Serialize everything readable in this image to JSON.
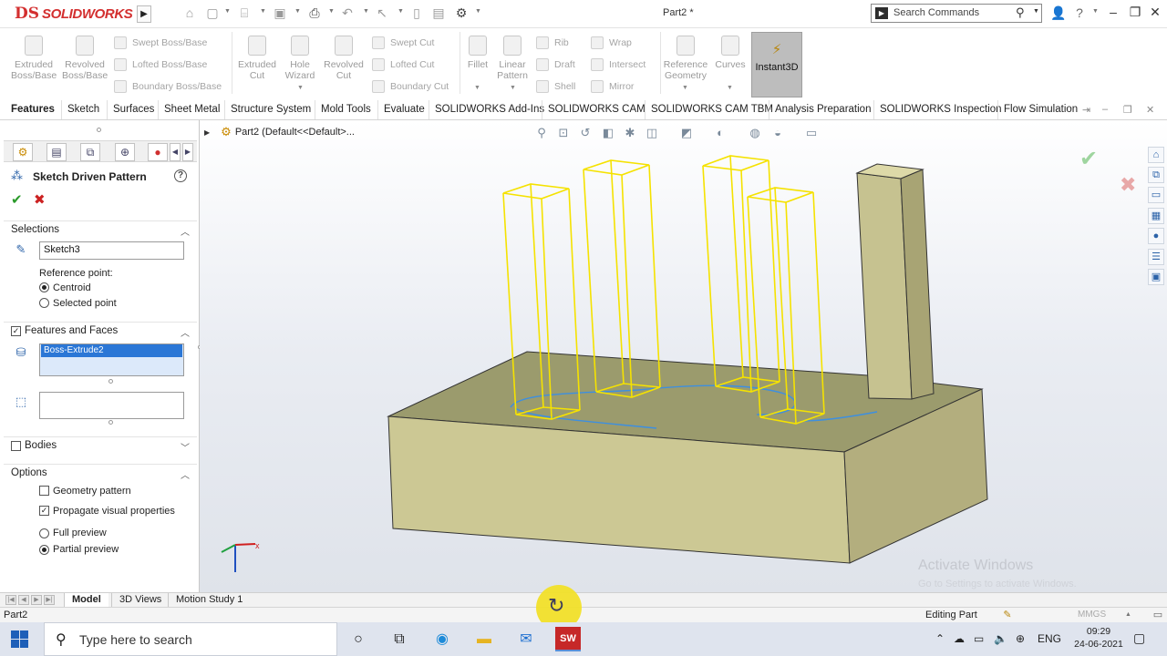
{
  "app": {
    "brand": "SOLIDWORKS",
    "brand_mark": "DS",
    "doc_title": "Part2 *",
    "search_placeholder": "Search Commands"
  },
  "ribbon": {
    "big_buttons": [
      {
        "label": "Extruded\nBoss/Base",
        "icon": "extrude-boss-icon"
      },
      {
        "label": "Revolved\nBoss/Base",
        "icon": "revolve-boss-icon"
      },
      {
        "label": "Extruded\nCut",
        "icon": "extrude-cut-icon"
      },
      {
        "label": "Hole\nWizard",
        "icon": "hole-wizard-icon"
      },
      {
        "label": "Revolved\nCut",
        "icon": "revolve-cut-icon"
      },
      {
        "label": "Fillet",
        "icon": "fillet-icon"
      },
      {
        "label": "Linear\nPattern",
        "icon": "linear-pattern-icon"
      },
      {
        "label": "Reference\nGeometry",
        "icon": "reference-geometry-icon"
      },
      {
        "label": "Curves",
        "icon": "curves-icon"
      }
    ],
    "small_buttons": [
      "Swept Boss/Base",
      "Lofted Boss/Base",
      "Boundary Boss/Base",
      "Swept Cut",
      "Lofted Cut",
      "Boundary Cut",
      "Rib",
      "Draft",
      "Shell",
      "Wrap",
      "Intersect",
      "Mirror"
    ],
    "instant3d": "Instant3D"
  },
  "tabs": [
    "Features",
    "Sketch",
    "Surfaces",
    "Sheet Metal",
    "Structure System",
    "Mold Tools",
    "Evaluate",
    "SOLIDWORKS Add-Ins",
    "SOLIDWORKS CAM",
    "SOLIDWORKS CAM TBM",
    "Analysis Preparation",
    "SOLIDWORKS Inspection",
    "Flow Simulation"
  ],
  "property_manager": {
    "title": "Sketch Driven Pattern",
    "sections": {
      "selections": "Selections",
      "features_faces": "Features and Faces",
      "bodies": "Bodies",
      "options": "Options"
    },
    "sketch_value": "Sketch3",
    "reference_point_label": "Reference point:",
    "centroid": "Centroid",
    "selected_point": "Selected point",
    "feature_item": "Boss-Extrude2",
    "geometry_pattern": "Geometry pattern",
    "propagate_visual": "Propagate visual properties",
    "full_preview": "Full preview",
    "partial_preview": "Partial preview"
  },
  "viewport": {
    "breadcrumb": "Part2  (Default<<Default>...",
    "watermark_title": "Activate Windows",
    "watermark_sub": "Go to Settings to activate Windows.",
    "colors": {
      "body_top": "#9a9a6a",
      "body_front": "#c9c592",
      "body_side": "#b2ad7c",
      "preview": "#f5e200",
      "sketch": "#3d8fe0"
    }
  },
  "bottom_tabs": [
    "Model",
    "3D Views",
    "Motion Study 1"
  ],
  "status": {
    "left": "Part2",
    "editing": "Editing Part",
    "units": "MMGS"
  },
  "taskbar": {
    "search": "Type here to search",
    "lang": "ENG",
    "time": "09:29",
    "date": "24-06-2021",
    "sw_badge": "SW"
  }
}
